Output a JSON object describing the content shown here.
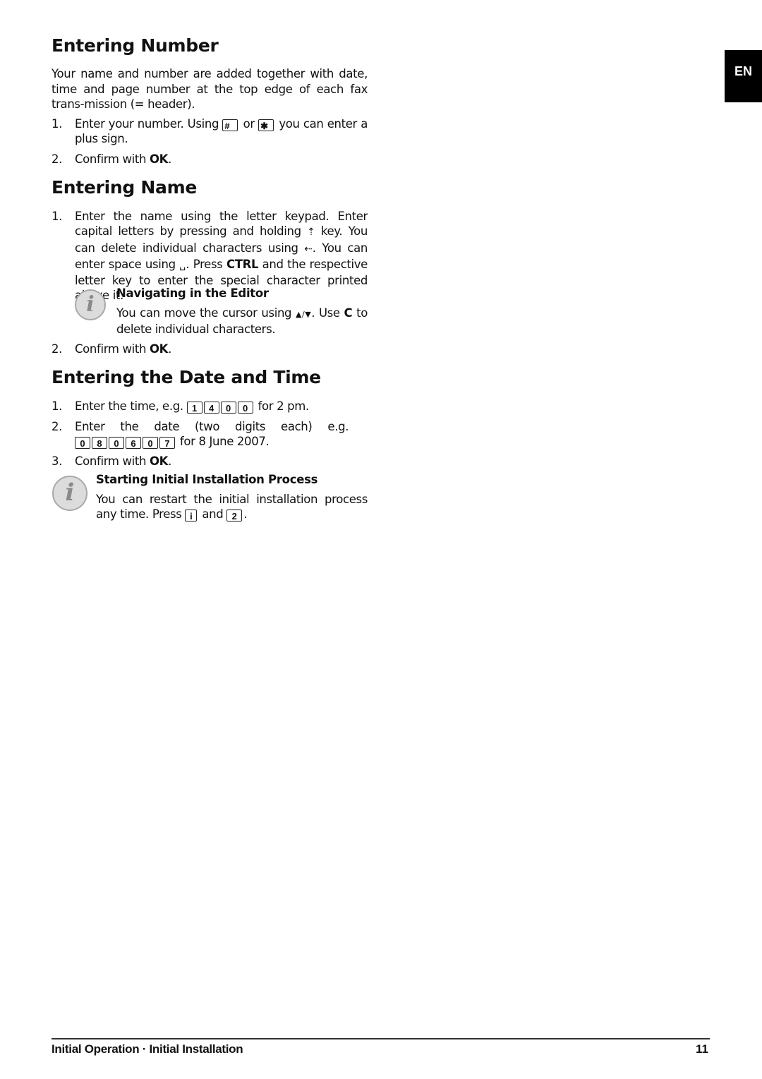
{
  "language_tab": "EN",
  "sections": {
    "number": {
      "title": "Entering Number",
      "intro": "Your name and number are added together with date, time and page number at the top edge of each fax trans-mission (= header).",
      "step1_num": "1.",
      "step1_a": "Enter your number. Using",
      "key_hash": "#",
      "step1_or": "or",
      "key_star": "✱",
      "step1_b": "you can enter a plus sign.",
      "step2_num": "2.",
      "step2_a": "Confirm with",
      "step2_ok": "OK",
      "step2_end": "."
    },
    "name": {
      "title": "Entering Name",
      "step1_num": "1.",
      "step1_a": "Enter the name using the letter keypad. Enter capital letters by pressing and holding",
      "shift_symbol": "⇡",
      "step1_b": "key. You can delete individual characters using",
      "backspace_symbol": "⇠",
      "step1_c": ". You can enter space using",
      "space_symbol": "␣",
      "step1_d": ". Press",
      "ctrl_label": "CTRL",
      "step1_e": "and the respective letter key to enter the special character printed above it.",
      "note": {
        "title": "Navigating in the Editor",
        "body_a": "You can move the cursor using",
        "arrows": "▲/▼",
        "body_b": ". Use",
        "c_key": "C",
        "body_c": "to delete individual characters."
      },
      "step2_num": "2.",
      "step2_a": "Confirm with",
      "step2_ok": "OK",
      "step2_end": "."
    },
    "datetime": {
      "title": "Entering the Date and Time",
      "step1_num": "1.",
      "step1_a": "Enter the time, e.g.",
      "time_keys": [
        "1",
        "4",
        "0",
        "0"
      ],
      "step1_b": "for 2 pm.",
      "step2_num": "2.",
      "step2_a": "Enter the date (two digits each) e.g.",
      "date_keys": [
        "0",
        "8",
        "0",
        "6",
        "0",
        "7"
      ],
      "step2_b": "for 8 June 2007.",
      "step3_num": "3.",
      "step3_a": "Confirm with",
      "step3_ok": "OK",
      "step3_end": ".",
      "note": {
        "title": "Starting Initial Installation Process",
        "body_a": "You can restart the initial installation process any time. Press",
        "key_i": "i",
        "body_and": "and",
        "key_2": "2",
        "body_end": "."
      }
    }
  },
  "footer": {
    "section": "Initial Operation · Initial Installation",
    "page_number": "11"
  }
}
